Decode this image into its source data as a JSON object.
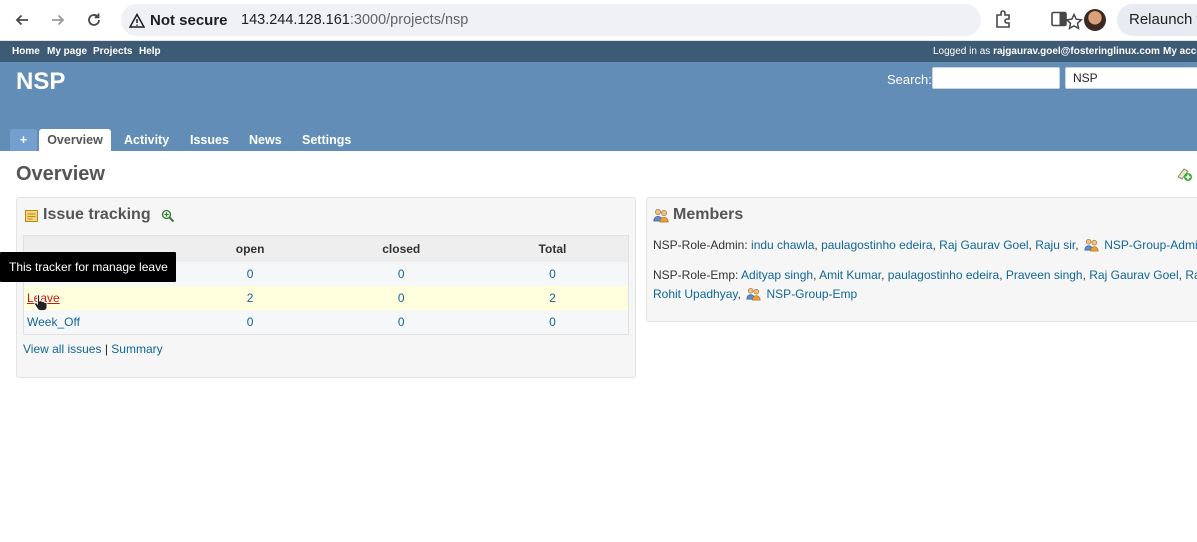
{
  "browser": {
    "security_label": "Not secure",
    "url_host": "143.244.128.161",
    "url_rest": ":3000/projects/nsp",
    "relaunch_label": "Relaunch t"
  },
  "top_menu": {
    "links": [
      "Home",
      "My page",
      "Projects",
      "Help"
    ],
    "logged_in_prefix": "Logged in as ",
    "logged_in_user": "rajgaurav.goel@fosteringlinux.com",
    "my_account": "My acco"
  },
  "header": {
    "project_title": "NSP",
    "search_label": "Search:",
    "search_value": "",
    "project_jump_value": "NSP"
  },
  "main_menu": {
    "new": "+",
    "tabs": [
      "Overview",
      "Activity",
      "Issues",
      "News",
      "Settings"
    ]
  },
  "content": {
    "heading": "Overview"
  },
  "issue_tracking": {
    "title": "Issue tracking",
    "columns": [
      "",
      "open",
      "closed",
      "Total"
    ],
    "rows": [
      {
        "name": "",
        "open": "0",
        "closed": "0",
        "total": "0"
      },
      {
        "name": "Leave",
        "open": "2",
        "closed": "0",
        "total": "2"
      },
      {
        "name": "Week_Off",
        "open": "0",
        "closed": "0",
        "total": "0"
      }
    ],
    "view_all": "View all issues",
    "separator": " | ",
    "summary": "Summary",
    "tooltip": "This tracker for manage leave"
  },
  "members": {
    "title": "Members",
    "admin_role": "NSP-Role-Admin: ",
    "admin_members": [
      "indu chawla",
      "paulagostinho edeira",
      "Raj Gaurav Goel",
      "Raju sir"
    ],
    "admin_group": "NSP-Group-Admin",
    "emp_role": "NSP-Role-Emp: ",
    "emp_members": [
      "Adityap singh",
      "Amit Kumar",
      "paulagostinho edeira",
      "Praveen singh",
      "Raj Gaurav Goel",
      "Ra"
    ],
    "emp_members_line2": [
      "Rohit Upadhyay"
    ],
    "emp_group": "NSP-Group-Emp"
  },
  "colors": {
    "top_menu_bg": "#3e5b76",
    "header_bg": "#628db6",
    "link": "#116699",
    "hover_link": "#c61a1a"
  }
}
